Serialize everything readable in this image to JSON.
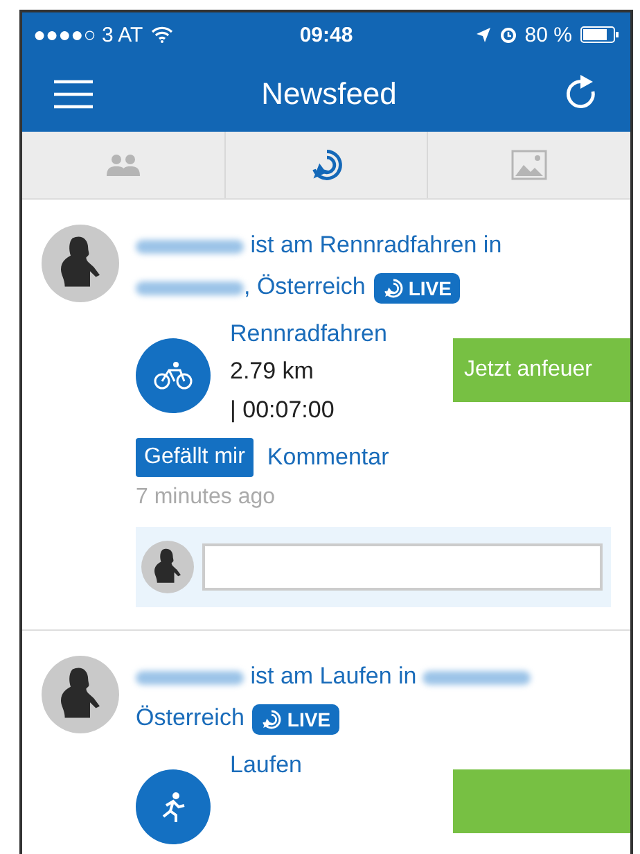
{
  "status_bar": {
    "carrier": "●●●●○ 3 AT",
    "time": "09:48",
    "battery": "80 %"
  },
  "nav": {
    "title": "Newsfeed"
  },
  "tabs": [
    {
      "kind": "people",
      "selected": false
    },
    {
      "kind": "live",
      "selected": true
    },
    {
      "kind": "picture",
      "selected": false
    }
  ],
  "posts": [
    {
      "headline": [
        {
          "kind": "blur"
        },
        {
          "kind": "text",
          "text": " ist am Rennradfahren in "
        },
        {
          "kind": "blur"
        },
        {
          "kind": "text",
          "text": ", Österreich"
        }
      ],
      "live": "LIVE",
      "activity": {
        "kind": "bike",
        "name": "Rennradfahren",
        "distance": "2.79 km",
        "duration": "| 00:07:00",
        "button": "Jetzt anfeuer"
      },
      "like": "Gefällt mir",
      "comment": "Kommentar",
      "time": "7 minutes ago",
      "comment_box": true
    },
    {
      "headline": [
        {
          "kind": "blur"
        },
        {
          "kind": "text",
          "text": " ist am Laufen in "
        },
        {
          "kind": "blur"
        },
        {
          "kind": "text",
          "text": " Österreich"
        }
      ],
      "live": "LIVE",
      "activity": {
        "kind": "run",
        "name": "Laufen"
      }
    }
  ]
}
